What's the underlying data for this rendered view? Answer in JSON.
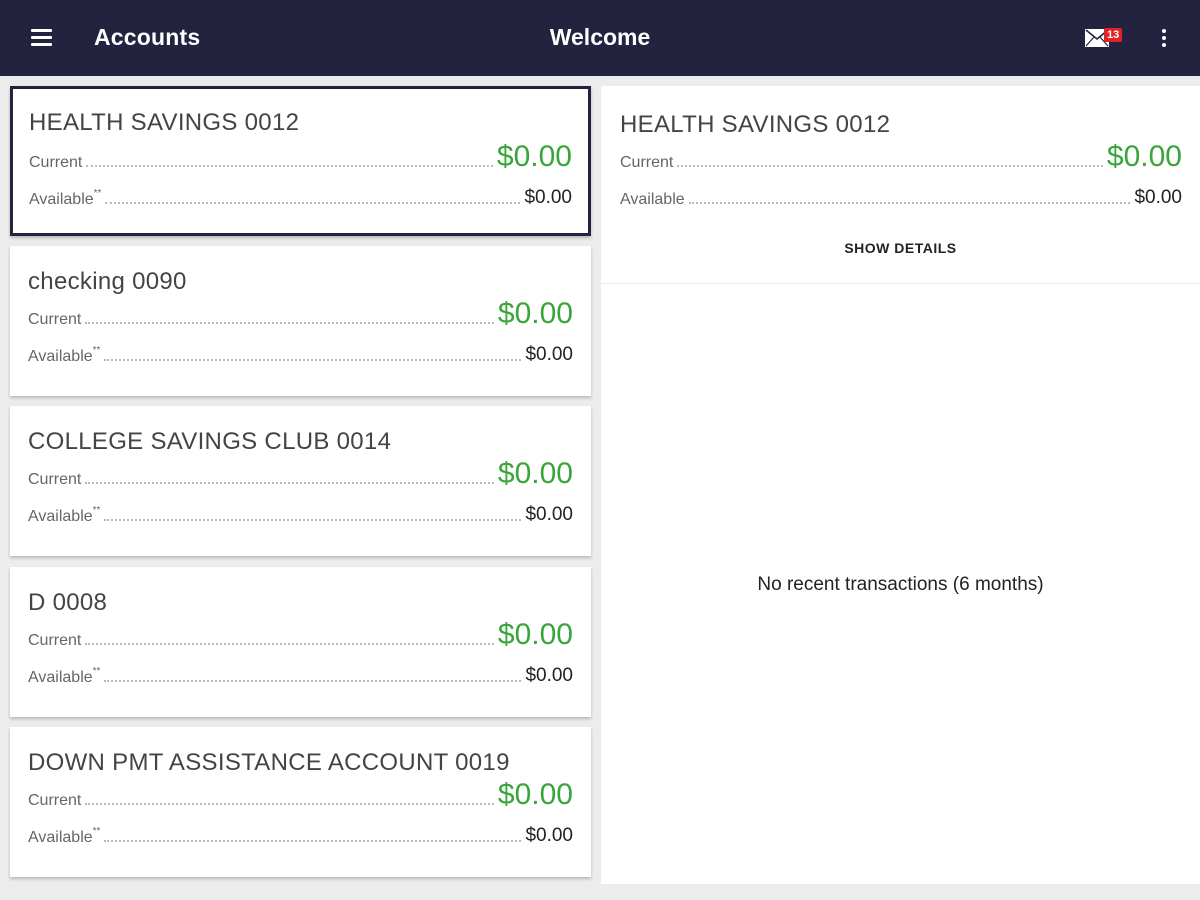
{
  "appbar": {
    "title": "Accounts",
    "center_title": "Welcome",
    "mail_badge": "13",
    "bar_color": "#23223f"
  },
  "accounts": [
    {
      "name": "HEALTH SAVINGS 0012",
      "current_label": "Current",
      "current": "$0.00",
      "available_label": "Available",
      "available_mark": "**",
      "available": "$0.00"
    },
    {
      "name": "checking 0090",
      "current_label": "Current",
      "current": "$0.00",
      "available_label": "Available",
      "available_mark": "**",
      "available": "$0.00"
    },
    {
      "name": "COLLEGE SAVINGS CLUB 0014",
      "current_label": "Current",
      "current": "$0.00",
      "available_label": "Available",
      "available_mark": "**",
      "available": "$0.00"
    },
    {
      "name": "D 0008",
      "current_label": "Current",
      "current": "$0.00",
      "available_label": "Available",
      "available_mark": "**",
      "available": "$0.00"
    },
    {
      "name": "DOWN PMT ASSISTANCE ACCOUNT 0019",
      "current_label": "Current",
      "current": "$0.00",
      "available_label": "Available",
      "available_mark": "**",
      "available": "$0.00"
    }
  ],
  "detail": {
    "name": "HEALTH SAVINGS 0012",
    "current_label": "Current",
    "current": "$0.00",
    "available_label": "Available",
    "available": "$0.00",
    "show_details": "SHOW DETAILS",
    "empty_message": "No recent transactions (6 months)"
  },
  "colors": {
    "positive_balance": "#3aa53a"
  },
  "icons": {
    "menu": "menu-icon",
    "mail": "mail-icon",
    "overflow": "more-vert-icon"
  }
}
